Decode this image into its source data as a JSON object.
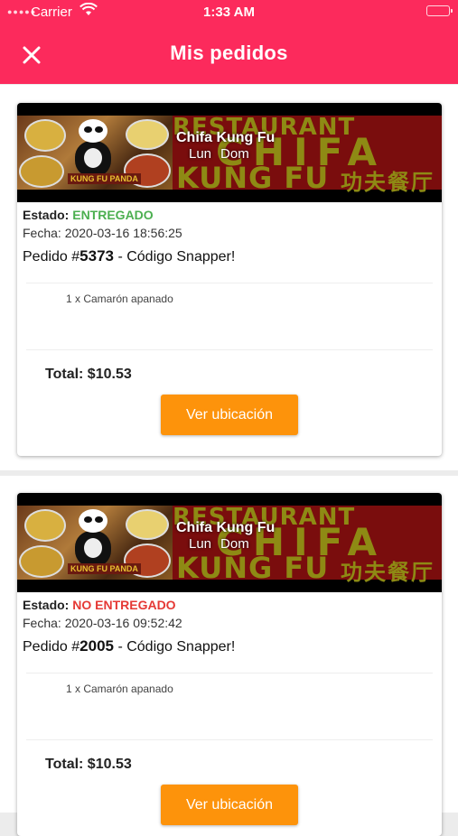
{
  "status_bar": {
    "carrier": "Carrier",
    "time": "1:33 AM"
  },
  "header": {
    "title": "Mis pedidos",
    "close_icon": "close-icon"
  },
  "colors": {
    "header_bg": "#fc2a5c",
    "button_bg": "#fd930b",
    "delivered": "#4caf50",
    "not_delivered": "#e53935"
  },
  "orders": [
    {
      "restaurant": {
        "name": "Chifa Kung Fu",
        "day_from": "Lun",
        "day_to": "Dom",
        "banner_text_1": "RESTAURANT",
        "banner_text_2": "CHIFA",
        "banner_text_3": "KUNG FU",
        "banner_text_4": "功夫餐厅",
        "banner_logo": "KUNG FU PANDA"
      },
      "estado_label": "Estado:",
      "estado_value": "ENTREGADO",
      "fecha_label": "Fecha:",
      "fecha_value": "2020-03-16 18:56:25",
      "pedido_label": "Pedido #",
      "pedido_number": "5373",
      "pedido_suffix": " -  Código Snapper!",
      "items": [
        "1 x Camarón apanado"
      ],
      "total": "Total: $10.53",
      "button_label": "Ver ubicación"
    },
    {
      "restaurant": {
        "name": "Chifa Kung Fu",
        "day_from": "Lun",
        "day_to": "Dom",
        "banner_text_1": "RESTAURANT",
        "banner_text_2": "CHIFA",
        "banner_text_3": "KUNG FU",
        "banner_text_4": "功夫餐厅",
        "banner_logo": "KUNG FU PANDA"
      },
      "estado_label": "Estado:",
      "estado_value": "NO ENTREGADO",
      "fecha_label": "Fecha:",
      "fecha_value": "2020-03-16 09:52:42",
      "pedido_label": "Pedido #",
      "pedido_number": "2005",
      "pedido_suffix": " -  Código Snapper!",
      "items": [
        "1 x Camarón apanado"
      ],
      "total": "Total: $10.53",
      "button_label": "Ver ubicación"
    }
  ]
}
